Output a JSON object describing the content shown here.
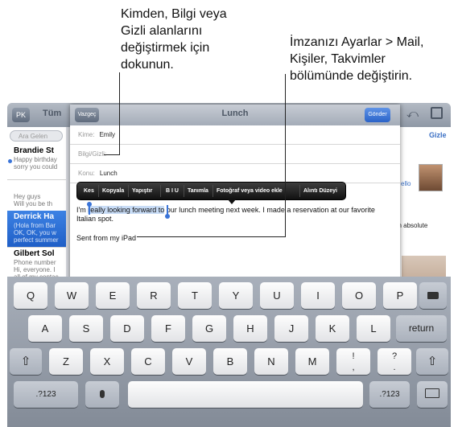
{
  "callouts": {
    "left": [
      "Kimden, Bilgi veya",
      "Gizli alanlarını",
      "değiştirmek için",
      "dokunun."
    ],
    "right": [
      "İmzanızı Ayarlar > Mail,",
      "Kişiler, Takvimler",
      "bölümünde değiştirin."
    ]
  },
  "topbar": {
    "back_label": "PK",
    "mailbox_label": "Tüm",
    "reply_icon": "reply-icon",
    "compose_icon": "compose-icon",
    "hide_label": "Gizle"
  },
  "list": {
    "search_placeholder": "Ara Gelen",
    "messages": [
      {
        "from": "Brandie St",
        "line1": "Happy birthday",
        "line2": "sorry you could",
        "selected": false
      },
      {
        "from": "",
        "line1": "Hey guys",
        "line2": "Will you be th",
        "selected": false
      },
      {
        "from": "Derrick Ha",
        "line1": "(Hola from Bar",
        "line2": "OK, OK, you w",
        "line3": "perfect summer",
        "selected": true
      },
      {
        "from": "Gilbert Sol",
        "line1": "Phone number",
        "line2": "Hi, everyone. I",
        "line3": "all of my contac",
        "selected": false
      }
    ]
  },
  "reading_pane": {
    "snippet_1": "ello",
    "snippet_2": "an absolute"
  },
  "compose": {
    "cancel_label": "Vazgeç",
    "title": "Lunch",
    "send_label": "Gönder",
    "to_label": "Kime:",
    "to_value": "Emily",
    "cc_label": "Bilgi/Gizli:",
    "subject_label": "Konu:",
    "subject_value": "Lunch",
    "body_selected": "really looking forward to",
    "body_before": "I'm ",
    "body_after": " our lunch meeting next week. I made a reservation at our favorite",
    "body_line2": "Italian spot.",
    "signature": "Sent from my iPad"
  },
  "edit_menu": [
    "Kes",
    "Kopyala",
    "Yapıştır",
    "B I U",
    "Tanımla",
    "Fotoğraf veya video ekle",
    "Alıntı Düzeyi"
  ],
  "keyboard": {
    "row1": [
      "Q",
      "W",
      "E",
      "R",
      "T",
      "Y",
      "U",
      "I",
      "O",
      "P"
    ],
    "row2": [
      "A",
      "S",
      "D",
      "F",
      "G",
      "H",
      "J",
      "K",
      "L"
    ],
    "row3": [
      "Z",
      "X",
      "C",
      "V",
      "B",
      "N",
      "M",
      "!",
      ",",
      "?",
      "."
    ],
    "return_label": "return",
    "numbers_label": ".?123",
    "delete_icon": "delete-icon",
    "shift_icon": "shift-icon",
    "mic_icon": "microphone-icon",
    "keyboard_icon": "hide-keyboard-icon"
  }
}
